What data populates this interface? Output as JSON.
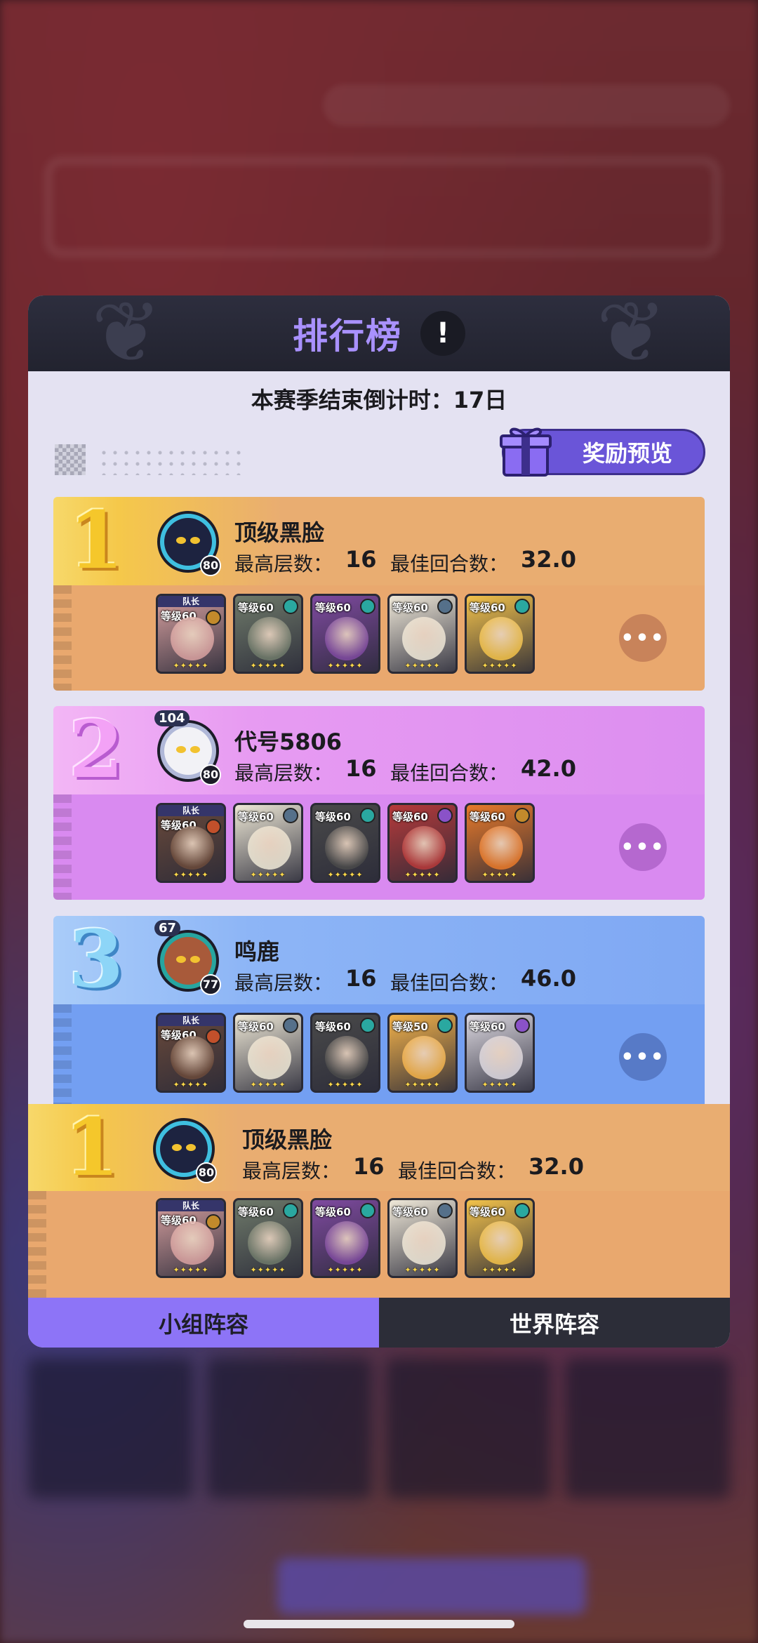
{
  "header": {
    "title": "排行榜",
    "info_label": "!"
  },
  "countdown": "本赛季结束倒计时：17日",
  "reward_button": "奖励预览",
  "labels": {
    "max_floor": "最高层数：",
    "best_round": "最佳回合数：",
    "captain": "队长",
    "more": "•••"
  },
  "rankings": [
    {
      "rank": "1",
      "name": "顶级黑脸",
      "level": "80",
      "max_floor": "16",
      "best_round": "32.0",
      "heroes": [
        {
          "level": "等级60",
          "captain": true,
          "color": "#d9a1a0",
          "elem": "#c28a2b"
        },
        {
          "level": "等级60",
          "captain": false,
          "color": "#6f7a6a",
          "elem": "#2aa8a0"
        },
        {
          "level": "等级60",
          "captain": false,
          "color": "#7f4aa0",
          "elem": "#2aa8a0"
        },
        {
          "level": "等级60",
          "captain": false,
          "color": "#efe8d8",
          "elem": "#55708a"
        },
        {
          "level": "等级60",
          "captain": false,
          "color": "#f3c24a",
          "elem": "#2aa8a0"
        }
      ]
    },
    {
      "rank": "2",
      "name": "代号5806",
      "level": "80",
      "badge": "104",
      "max_floor": "16",
      "best_round": "42.0",
      "heroes": [
        {
          "level": "等级60",
          "captain": true,
          "color": "#6b4a3a",
          "elem": "#c2502b"
        },
        {
          "level": "等级60",
          "captain": false,
          "color": "#eee8d6",
          "elem": "#55708a"
        },
        {
          "level": "等级60",
          "captain": false,
          "color": "#4a4a4a",
          "elem": "#2aa8a0"
        },
        {
          "level": "等级60",
          "captain": false,
          "color": "#b73a3a",
          "elem": "#8a52c8"
        },
        {
          "level": "等级60",
          "captain": false,
          "color": "#e97a2a",
          "elem": "#c28a2b"
        }
      ]
    },
    {
      "rank": "3",
      "name": "鸣鹿",
      "level": "77",
      "badge": "67",
      "max_floor": "16",
      "best_round": "46.0",
      "heroes": [
        {
          "level": "等级60",
          "captain": true,
          "color": "#6b4a3a",
          "elem": "#c2502b"
        },
        {
          "level": "等级60",
          "captain": false,
          "color": "#eee8d6",
          "elem": "#55708a"
        },
        {
          "level": "等级60",
          "captain": false,
          "color": "#4a4a4a",
          "elem": "#2aa8a0"
        },
        {
          "level": "等级50",
          "captain": false,
          "color": "#f3b24a",
          "elem": "#2aa8a0"
        },
        {
          "level": "等级60",
          "captain": false,
          "color": "#dcd8e0",
          "elem": "#8a52c8"
        }
      ]
    }
  ],
  "my_rank": {
    "rank": "1",
    "name": "顶级黑脸",
    "level": "80",
    "max_floor": "16",
    "best_round": "32.0",
    "heroes": [
      {
        "level": "等级60",
        "captain": true,
        "color": "#d9a1a0",
        "elem": "#c28a2b"
      },
      {
        "level": "等级60",
        "captain": false,
        "color": "#6f7a6a",
        "elem": "#2aa8a0"
      },
      {
        "level": "等级60",
        "captain": false,
        "color": "#7f4aa0",
        "elem": "#2aa8a0"
      },
      {
        "level": "等级60",
        "captain": false,
        "color": "#efe8d8",
        "elem": "#55708a"
      },
      {
        "level": "等级60",
        "captain": false,
        "color": "#f3c24a",
        "elem": "#2aa8a0"
      }
    ]
  },
  "tabs": {
    "group": "小组阵容",
    "world": "世界阵容"
  }
}
